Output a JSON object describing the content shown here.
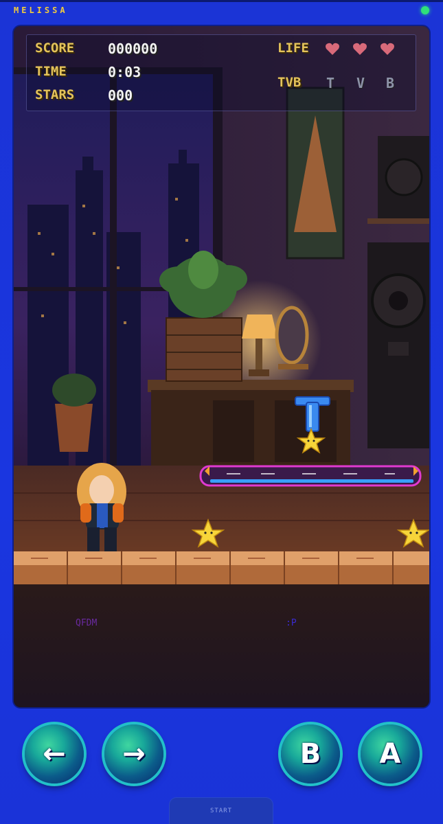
{
  "app": {
    "title": "MELISSA"
  },
  "hud": {
    "score_label": "SCORE",
    "score_value": "000000",
    "time_label": "TIME",
    "time_value": "0:03",
    "stars_label": "STARS",
    "stars_value": "000",
    "life_label": "LIFE",
    "lives": 3,
    "tvb_label": "TVB",
    "tvb_letters": [
      "T",
      "V",
      "B"
    ]
  },
  "scene_text": {
    "left": "QFDM",
    "right": ":P"
  },
  "powerup": {
    "letter": "T"
  },
  "controls": {
    "left_glyph": "←",
    "right_glyph": "→",
    "b_label": "B",
    "a_label": "A",
    "start_label": "START"
  },
  "colors": {
    "accent_gold": "#e4c35a",
    "heart": "#d86a7a",
    "status": "#2fe07a",
    "frame_blue": "#1a36e0"
  }
}
